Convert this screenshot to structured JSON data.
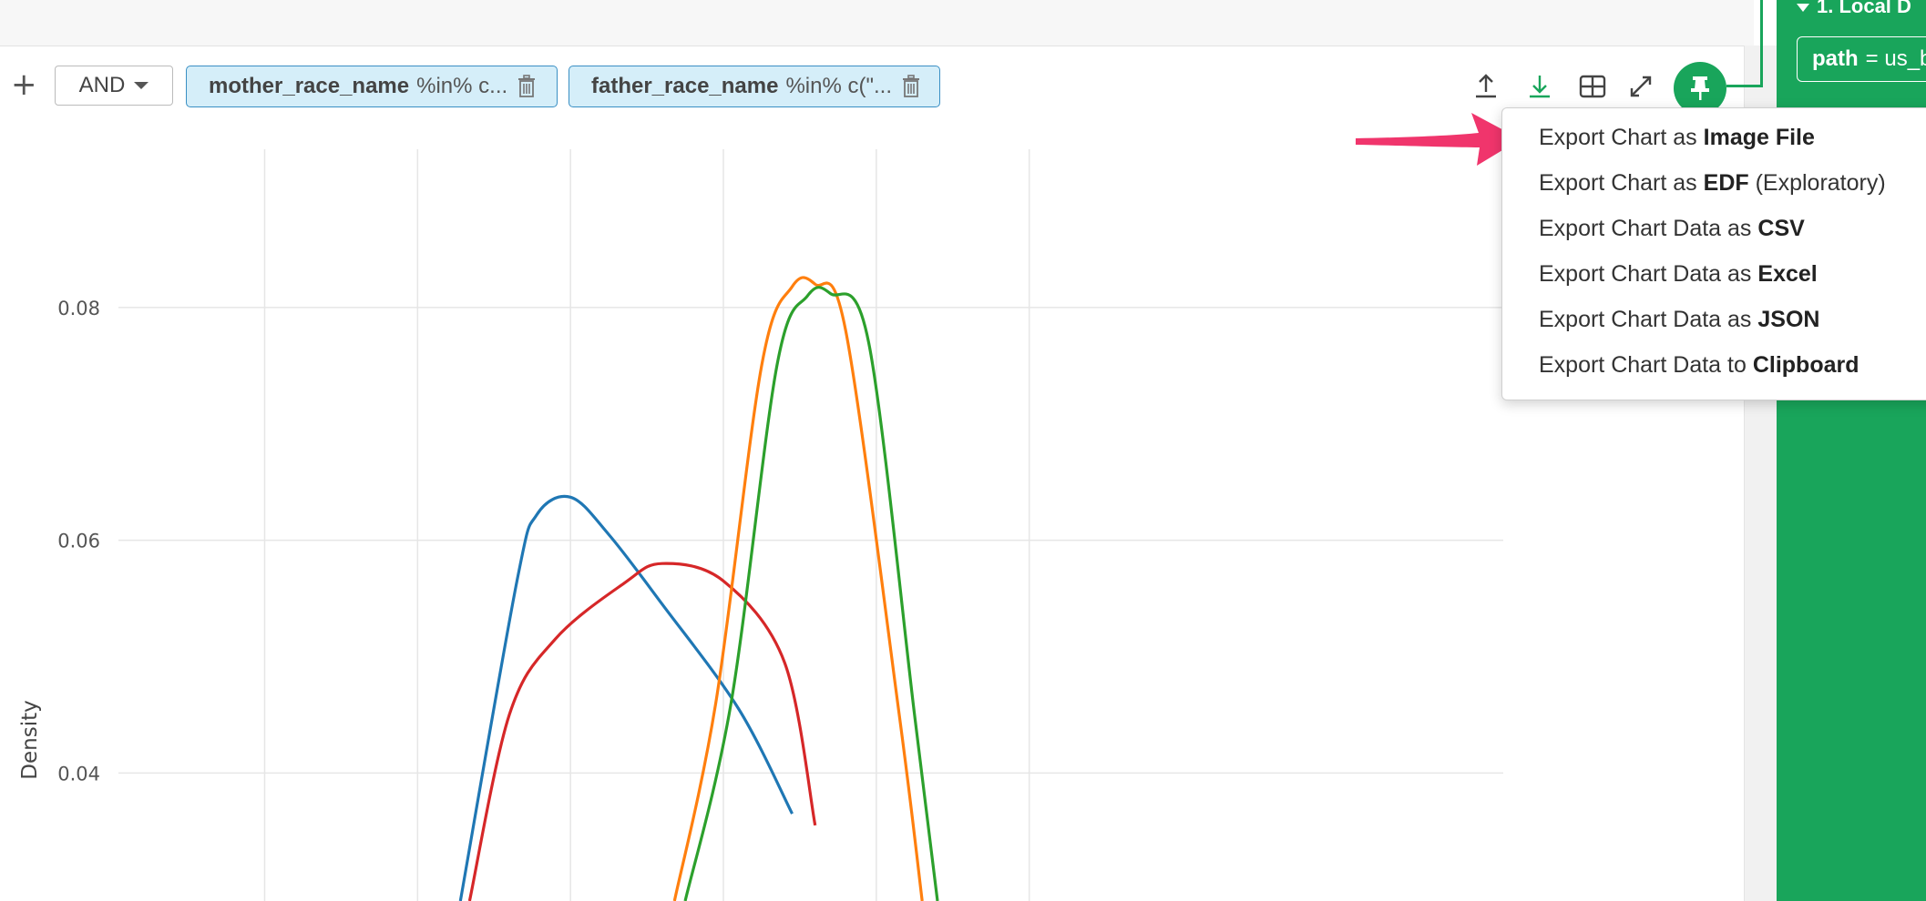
{
  "filterbar": {
    "plus": "+",
    "operator": "AND",
    "chips": [
      {
        "column": "mother_race_name",
        "expr": "%in% c..."
      },
      {
        "column": "father_race_name",
        "expr": "%in% c(\"..."
      }
    ]
  },
  "toolbar_icons": [
    "upload-icon",
    "download-icon",
    "table-icon",
    "expand-icon",
    "pin-icon"
  ],
  "right_panel": {
    "step_title": "1. Local D",
    "field_key": "path",
    "field_value": "= us_b"
  },
  "export_menu": {
    "items": [
      {
        "prefix": "Export Chart as ",
        "bold": "Image File",
        "suffix": ""
      },
      {
        "prefix": "Export Chart as ",
        "bold": "EDF",
        "suffix": " (Exploratory)"
      },
      {
        "prefix": "Export Chart Data as ",
        "bold": "CSV",
        "suffix": ""
      },
      {
        "prefix": "Export Chart Data as ",
        "bold": "Excel",
        "suffix": ""
      },
      {
        "prefix": "Export Chart Data as ",
        "bold": "JSON",
        "suffix": ""
      },
      {
        "prefix": "Export Chart Data to ",
        "bold": "Clipboard",
        "suffix": ""
      }
    ]
  },
  "colors": {
    "accent_green": "#19a55b",
    "chip_bg": "#d5eef9",
    "chip_border": "#3a8fc4",
    "arrow_pink": "#f0356c"
  },
  "chart_data": {
    "type": "line",
    "ylabel": "Density",
    "y_ticks": [
      "0.04",
      "0.06",
      "0.08"
    ],
    "ylim": [
      0.029,
      0.0936
    ],
    "grid": true,
    "legend": "none",
    "series": [
      {
        "color": "#1f77b4",
        "x": [
          3.28,
          3.65,
          3.78,
          4.0,
          4.25,
          4.6,
          5.1,
          5.45
        ],
        "values": [
          0.029,
          0.0565,
          0.0622,
          0.0637,
          0.0605,
          0.0545,
          0.0455,
          0.0365
        ]
      },
      {
        "color": "#d62728",
        "x": [
          3.34,
          3.6,
          3.9,
          4.35,
          4.6,
          5.0,
          5.4,
          5.6
        ],
        "values": [
          0.029,
          0.045,
          0.0515,
          0.0563,
          0.058,
          0.0565,
          0.0495,
          0.0355
        ]
      },
      {
        "color": "#ff7f0e",
        "x": [
          4.68,
          4.95,
          5.25,
          5.45,
          5.6,
          5.8,
          6.15,
          6.3
        ],
        "values": [
          0.029,
          0.046,
          0.075,
          0.0818,
          0.082,
          0.078,
          0.045,
          0.029
        ]
      },
      {
        "color": "#2ca02c",
        "x": [
          4.75,
          5.05,
          5.35,
          5.55,
          5.7,
          5.95,
          6.25,
          6.4
        ],
        "values": [
          0.029,
          0.046,
          0.075,
          0.081,
          0.0812,
          0.077,
          0.045,
          0.029
        ]
      }
    ],
    "xlim": [
      1.3,
      10.1
    ],
    "x_grid": [
      2,
      3,
      4,
      5,
      6,
      7
    ]
  }
}
